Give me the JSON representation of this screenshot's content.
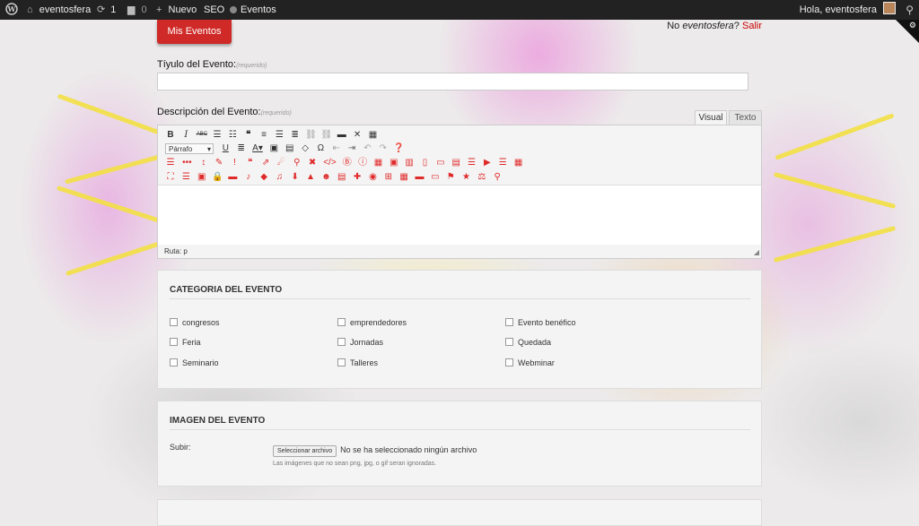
{
  "adminbar": {
    "site_name": "eventosfera",
    "updates_count": "1",
    "comments_count": "0",
    "new_label": "Nuevo",
    "seo_label": "SEO",
    "events_label": "Eventos",
    "greeting": "Hola, eventosfera"
  },
  "header": {
    "mis_eventos": "Mis Eventos",
    "not_user_prefix": "No ",
    "not_user_name": "eventosfera",
    "not_user_suffix": "? ",
    "logout": "Salir"
  },
  "form": {
    "title_label": "Tíyulo del Evento:",
    "required_note": "(requerido)",
    "description_label": "Descripción del Evento:",
    "tab_visual": "Visual",
    "tab_text": "Texto",
    "format_select": "Párrafo",
    "path_text": "Ruta: p"
  },
  "category": {
    "heading": "CATEGORIA DEL EVENTO",
    "options": [
      "congresos",
      "emprendedores",
      "Evento benéfico",
      "Feria",
      "Jornadas",
      "Quedada",
      "Seminario",
      "Talleres",
      "Webminar"
    ]
  },
  "image": {
    "heading": "IMAGEN DEL EVENTO",
    "upload_label": "Subir:",
    "choose_button": "Seleccionar archivo",
    "no_file": "No se ha seleccionado ningún archivo",
    "hint": "Las imágenes que no sean png, jpg, o gif seran ignoradas."
  },
  "icons": {
    "toolbar_row1": [
      "bold-icon",
      "italic-icon",
      "strikethrough-icon",
      "bullet-list-icon",
      "numbered-list-icon",
      "blockquote-icon",
      "align-left-icon",
      "align-center-icon",
      "align-right-icon",
      "link-icon",
      "unlink-icon",
      "more-icon",
      "fullscreen-icon",
      "kitchen-sink-icon"
    ],
    "toolbar_row2": [
      "underline-icon",
      "justify-icon",
      "text-color-icon",
      "paste-text-icon",
      "paste-word-icon",
      "clear-format-icon",
      "special-char-icon",
      "outdent-icon",
      "indent-icon",
      "undo-icon",
      "redo-icon",
      "help-icon"
    ]
  }
}
